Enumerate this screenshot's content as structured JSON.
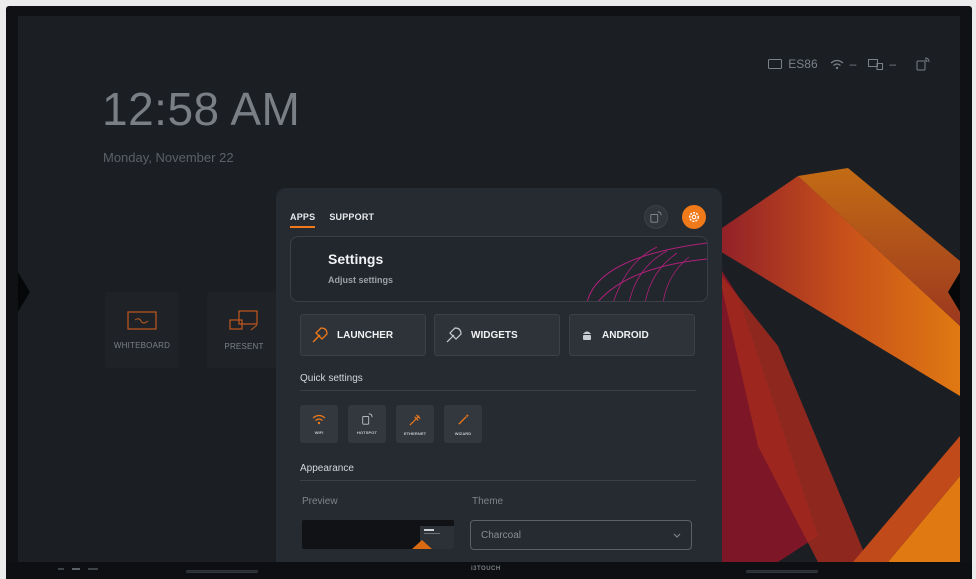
{
  "status_bar": {
    "input_source": "ES86",
    "wifi_value": "–",
    "ethernet_value": "–"
  },
  "home": {
    "time": "12:58 AM",
    "date": "Monday, November 22",
    "tiles": [
      {
        "label": "WHITEBOARD",
        "icon": "whiteboard-icon"
      },
      {
        "label": "PRESENT",
        "icon": "present-icon"
      }
    ]
  },
  "panel": {
    "tabs": [
      {
        "label": "APPS",
        "active": true
      },
      {
        "label": "SUPPORT",
        "active": false
      }
    ],
    "settings_card": {
      "title": "Settings",
      "subtitle": "Adjust settings"
    },
    "buttons": [
      {
        "label": "LAUNCHER",
        "icon": "rocket-icon"
      },
      {
        "label": "WIDGETS",
        "icon": "rocket-outline-icon"
      },
      {
        "label": "ANDROID",
        "icon": "android-icon"
      }
    ],
    "quick_settings": {
      "title": "Quick settings",
      "items": [
        {
          "label": "WIFI",
          "icon": "wifi-icon"
        },
        {
          "label": "HOTSPOT",
          "icon": "hotspot-icon"
        },
        {
          "label": "ETHERNET",
          "icon": "ethernet-icon"
        },
        {
          "label": "WIZARD",
          "icon": "wand-icon"
        }
      ]
    },
    "appearance": {
      "title": "Appearance",
      "preview_label": "Preview",
      "theme_label": "Theme",
      "theme_value": "Charcoal"
    }
  },
  "bezel": {
    "brand": "i3TOUCH"
  },
  "colors": {
    "accent": "#f07a1a",
    "screen_bg": "#1b1f24",
    "panel_bg": "#262b31",
    "diamond_red": "#8a1a2a",
    "diamond_orange": "#d96a12"
  }
}
